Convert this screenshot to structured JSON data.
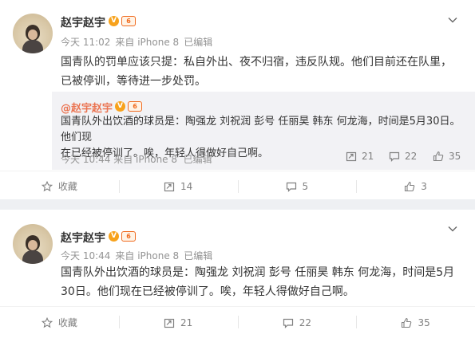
{
  "posts": [
    {
      "author": "赵宇赵宇",
      "v_badge": "V",
      "level_badge": "6",
      "time": "今天 11:02",
      "source": "来自 iPhone 8",
      "edited": "已编辑",
      "text_lines": [
        "国青队的罚单应该只提：私自外出、夜不归宿，违反队规。他们目前还在队里，",
        "已被停训，等待进一步处罚。"
      ],
      "quote": {
        "author": "@赵宇赵宇",
        "text_lines": [
          "国青队外出饮酒的球员是：陶强龙 刘祝润 彭号 任丽昊 韩东 何龙海，时间是5月30日。他们现",
          "在已经被停训了。唉，年轻人得做好自己啊。"
        ],
        "time": "今天 10:44",
        "source": "来自 iPhone 8",
        "edited": "已编辑",
        "reposts": "21",
        "comments": "22",
        "likes": "35"
      },
      "actions": {
        "favorite": "收藏",
        "reposts": "14",
        "comments": "5",
        "likes": "3"
      }
    },
    {
      "author": "赵宇赵宇",
      "v_badge": "V",
      "level_badge": "6",
      "time": "今天 10:44",
      "source": "来自 iPhone 8",
      "edited": "已编辑",
      "text_lines": [
        "国青队外出饮酒的球员是：陶强龙 刘祝润 彭号 任丽昊 韩东 何龙海，时间是5月",
        "30日。他们现在已经被停训了。唉，年轻人得做好自己啊。"
      ],
      "actions": {
        "favorite": "收藏",
        "reposts": "21",
        "comments": "22",
        "likes": "35"
      }
    }
  ]
}
